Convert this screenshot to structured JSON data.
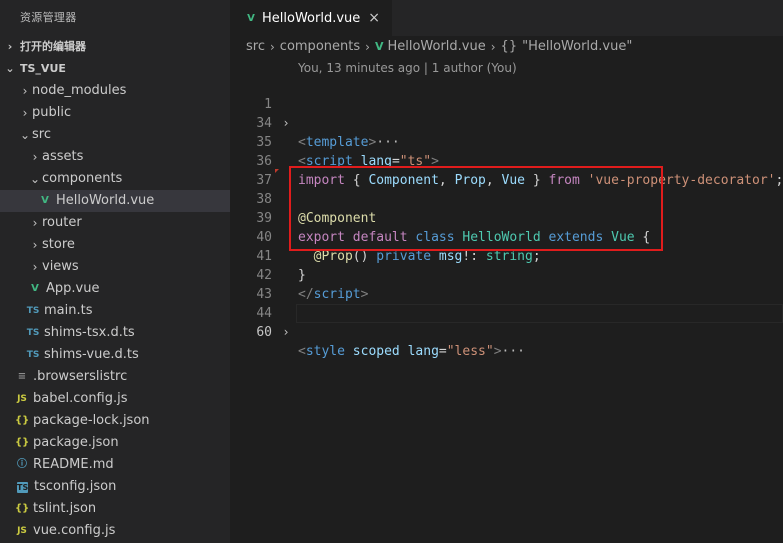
{
  "explorer": {
    "title": "资源管理器",
    "open_editors": "打开的编辑器",
    "project": "TS_VUE",
    "tree": {
      "node_modules": "node_modules",
      "public": "public",
      "src": "src",
      "assets": "assets",
      "components": "components",
      "helloworld": "HelloWorld.vue",
      "router": "router",
      "store": "store",
      "views": "views",
      "app": "App.vue",
      "main": "main.ts",
      "shims_tsx": "shims-tsx.d.ts",
      "shims_vue": "shims-vue.d.ts",
      "browserslistrc": ".browserslistrc",
      "babel": "babel.config.js",
      "package_lock": "package-lock.json",
      "package": "package.json",
      "readme": "README.md",
      "tsconfig": "tsconfig.json",
      "tslint": "tslint.json",
      "vue_config": "vue.config.js"
    },
    "icons": {
      "ts": "TS",
      "js": "JS",
      "json": "{}",
      "vue": "V",
      "info": "ⓘ",
      "lines": "≡"
    }
  },
  "tab": {
    "label": "HelloWorld.vue",
    "close": "×"
  },
  "breadcrumb": {
    "src": "src",
    "components": "components",
    "file": "HelloWorld.vue",
    "symbol_icon": "{}",
    "symbol": "\"HelloWorld.vue\""
  },
  "codelens": "You, 13 minutes ago | 1 author (You)",
  "code": {
    "lines": {
      "l1": "1",
      "l34": "34",
      "l35": "35",
      "l36": "36",
      "l37": "37",
      "l38": "38",
      "l39": "39",
      "l40": "40",
      "l41": "41",
      "l42": "42",
      "l43": "43",
      "l44": "44",
      "l60": "60"
    },
    "template_tag": "template",
    "script_tag": "script",
    "lang_attr": "lang",
    "lang_ts": "\"ts\"",
    "import_kw": "import",
    "component": "Component",
    "prop": "Prop",
    "vue": "Vue",
    "from_kw": "from",
    "module": "'vue-property-decorator'",
    "decorator": "@Component",
    "export_kw": "export",
    "default_kw": "default",
    "class_kw": "class",
    "class_name": "HelloWorld",
    "extends_kw": "extends",
    "base": "Vue",
    "prop_decorator": "@Prop",
    "private_kw": "private",
    "field": "msg",
    "type": "string",
    "style_tag": "style",
    "scoped_attr": "scoped",
    "lang_less": "\"less\"",
    "ellipsis": "···"
  },
  "colors": {
    "highlight_box": "#e01c1c",
    "vue_green": "#41b883",
    "ts_blue": "#519aba"
  }
}
